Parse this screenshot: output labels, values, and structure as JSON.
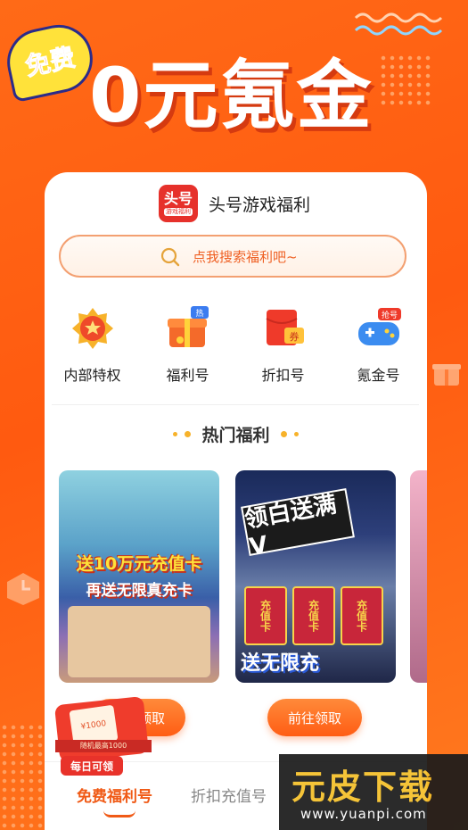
{
  "banner": {
    "free_badge": "免费",
    "title": "0元氪金"
  },
  "app": {
    "logo_text": "头号",
    "logo_sub": "游戏福利",
    "name": "头号游戏福利"
  },
  "search": {
    "placeholder": "点我搜索福利吧~"
  },
  "categories": [
    {
      "label": "内部特权",
      "icon": "crown-medal-icon"
    },
    {
      "label": "福利号",
      "icon": "gift-box-icon",
      "badge": "热"
    },
    {
      "label": "折扣号",
      "icon": "red-envelope-icon",
      "badge": "券"
    },
    {
      "label": "氪金号",
      "icon": "gamepad-icon",
      "badge": "抢号"
    }
  ],
  "section": {
    "title": "热门福利"
  },
  "games": [
    {
      "promo_line1": "送10万元充值卡",
      "promo_line2": "再送无限真充卡",
      "button": "前往领取"
    },
    {
      "promo_top": "领白送满V",
      "card_text": "充值卡",
      "promo_bottom": "送无限充",
      "button": "前往领取"
    }
  ],
  "promo_widget": {
    "card_text": "¥1000",
    "ribbon": "随机最高1000",
    "tag": "每日可领"
  },
  "bottom_tabs": [
    {
      "label": "免费福利号",
      "active": true
    },
    {
      "label": "折扣充值号",
      "active": false
    }
  ],
  "watermark": {
    "title": "元皮下载",
    "url": "www.yuanpi.com"
  },
  "colors": {
    "background": "#ff6a17",
    "accent": "#f05a16",
    "brand_red": "#e6312b"
  }
}
